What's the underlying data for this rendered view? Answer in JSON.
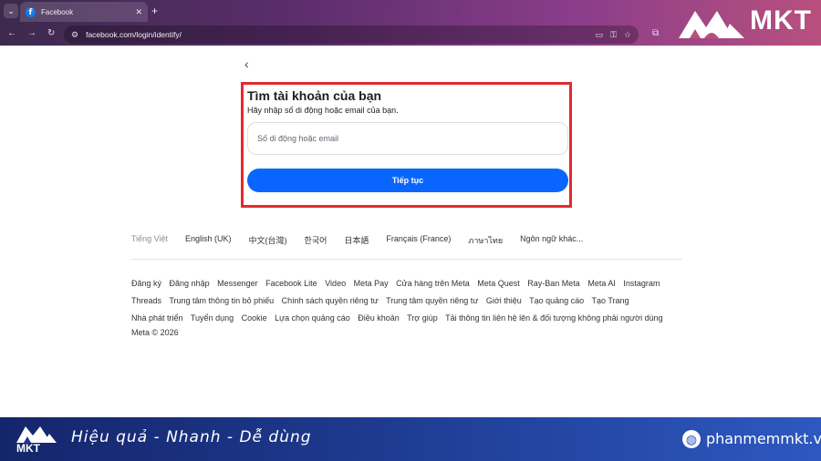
{
  "browser": {
    "tab_title": "Facebook",
    "url": "facebook.com/login/identify/"
  },
  "brand": {
    "logo_text": "MKT"
  },
  "page": {
    "title": "Tìm tài khoản của bạn",
    "subtitle": "Hãy nhập số di động hoặc email của bạn.",
    "input_placeholder": "Số di động hoặc email",
    "continue_label": "Tiếp tục"
  },
  "languages": [
    "Tiếng Việt",
    "English (UK)",
    "中文(台灣)",
    "한국어",
    "日本語",
    "Français (France)",
    "ภาษาไทย",
    "Ngôn ngữ khác..."
  ],
  "footer_links": {
    "row1": [
      "Đăng ký",
      "Đăng nhập",
      "Messenger",
      "Facebook Lite",
      "Video",
      "Meta Pay",
      "Cửa hàng trên Meta",
      "Meta Quest",
      "Ray-Ban Meta",
      "Meta AI",
      "Instagram"
    ],
    "row2": [
      "Threads",
      "Trung tâm thông tin bỏ phiếu",
      "Chính sách quyền riêng tư",
      "Trung tâm quyền riêng tư",
      "Giới thiệu",
      "Tạo quảng cáo",
      "Tạo Trang"
    ],
    "row3": [
      "Nhà phát triển",
      "Tuyển dụng",
      "Cookie",
      "Lựa chọn quảng cáo",
      "Điều khoản",
      "Trợ giúp",
      "Tải thông tin liên hệ lên & đối tượng không phải người dùng"
    ]
  },
  "copyright": "Meta © 2026",
  "banner": {
    "logo_text": "MKT",
    "slogan": "Hiệu quả - Nhanh  - Dễ dùng",
    "site": "phanmemmkt.vn"
  },
  "colors": {
    "primary_button": "#0866ff",
    "highlight_border": "#e4292d",
    "banner": "#1d3a8f"
  }
}
